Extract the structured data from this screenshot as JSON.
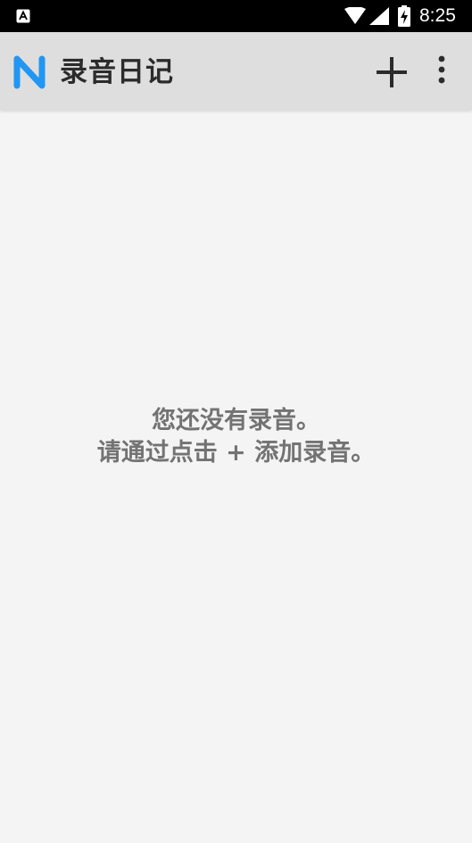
{
  "status_bar": {
    "time": "8:25",
    "icons": [
      "notification-a-icon",
      "wifi-icon",
      "signal-icon",
      "battery-charging-icon"
    ]
  },
  "app_bar": {
    "title": "录音日记",
    "logo_icon": "n-logo-icon",
    "actions": [
      "plus-icon",
      "more-vert-icon"
    ]
  },
  "empty_state": {
    "line1": "您还没有录音。",
    "line2": "请通过点击 + 添加录音。"
  },
  "colors": {
    "status_bar_bg": "#000000",
    "app_bar_bg": "#dedede",
    "page_bg": "#f4f4f4",
    "logo_blue": "#2196f3",
    "empty_text": "#737373"
  }
}
